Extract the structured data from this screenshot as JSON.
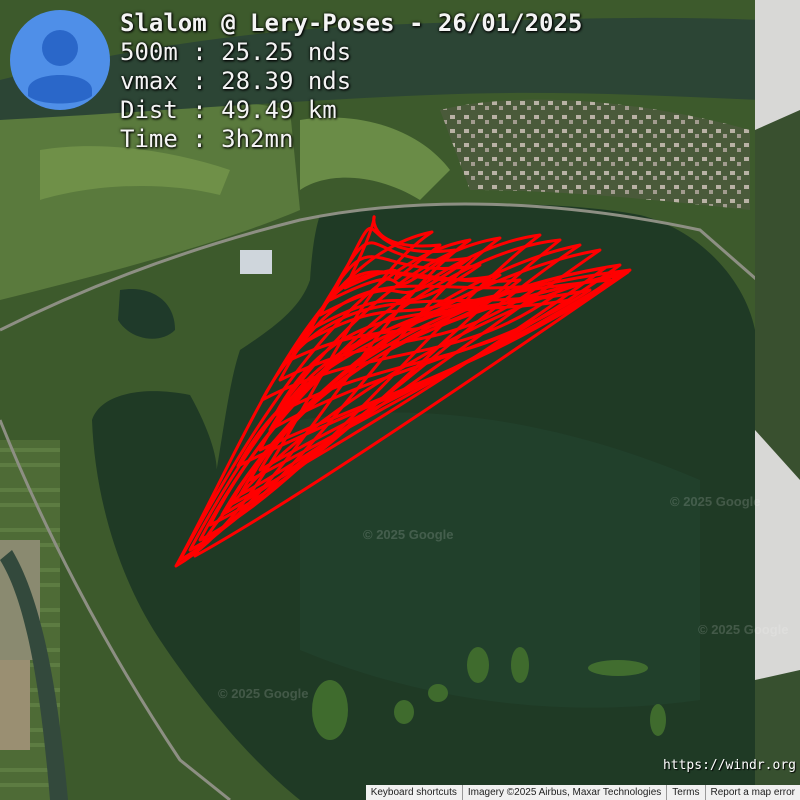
{
  "header": {
    "title": "Slalom @ Lery-Poses - 26/01/2025",
    "stats": [
      "500m : 25.25 nds",
      "vmax : 28.39 nds",
      "Dist : 49.49 km",
      "Time : 3h2mn"
    ]
  },
  "avatar_icon": "user-avatar-icon",
  "credit_url": "https://windr.org",
  "watermark": "© 2025 Google",
  "footer": {
    "keyboard": "Keyboard shortcuts",
    "imagery": "Imagery ©2025 Airbus, Maxar Technologies",
    "terms": "Terms",
    "report": "Report a map error"
  },
  "colors": {
    "track": "#ff0000",
    "avatar_bg": "#4f8fe8",
    "avatar_fg": "#2a67c9",
    "water": "#1f3a25"
  }
}
